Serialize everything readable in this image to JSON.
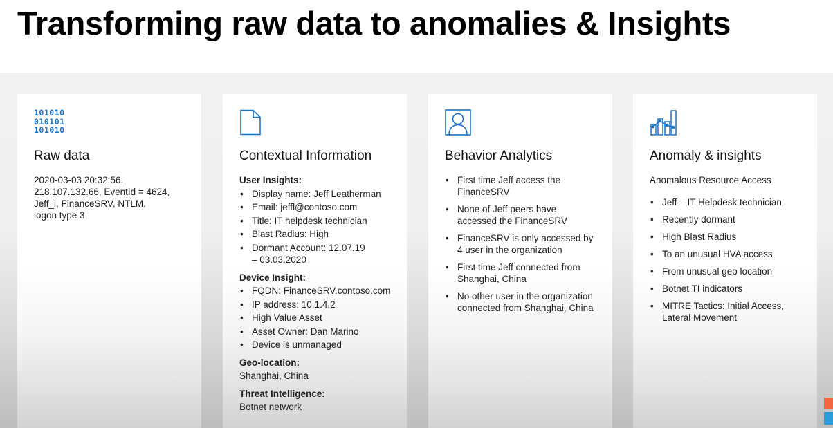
{
  "title": "Transforming raw data to anomalies & Insights",
  "colors": {
    "icon_accent": "#0a6fc9",
    "tile_orange": "#f0673f",
    "tile_blue": "#2a9bdd"
  },
  "cards": [
    {
      "icon": "binary-icon",
      "binary_lines": [
        "101010",
        "010101",
        "101010"
      ],
      "heading": "Raw data",
      "lines": [
        "2020-03-03 20:32:56,",
        "218.107.132.66, EventId = 4624,",
        "Jeff_l, FinanceSRV, NTLM,",
        "logon type 3"
      ]
    },
    {
      "icon": "document-icon",
      "heading": "Contextual Information",
      "sections": [
        {
          "title": "User Insights:",
          "items": [
            "Display name: Jeff Leatherman",
            "Email: jeffl@contoso.com",
            "Title: IT helpdesk technician",
            "Blast Radius: High",
            "Dormant Account: 12.07.19 – 03.03.2020"
          ]
        },
        {
          "title": "Device Insight:",
          "items": [
            "FQDN: FinanceSRV.contoso.com",
            "IP address: 10.1.4.2",
            "High Value Asset",
            "Asset Owner: Dan Marino",
            "Device is unmanaged"
          ]
        },
        {
          "title": "Geo-location:",
          "text": "Shanghai, China"
        },
        {
          "title": "Threat Intelligence:",
          "text": "Botnet network"
        }
      ]
    },
    {
      "icon": "user-icon",
      "heading": "Behavior Analytics",
      "items": [
        "First time Jeff access the FinanceSRV",
        "None of Jeff peers have accessed the FinanceSRV",
        "FinanceSRV is only accessed by 4 user in the organization",
        "First time Jeff connected from Shanghai, China",
        "No other user in the organization connected from Shanghai, China"
      ]
    },
    {
      "icon": "analytics-chart-icon",
      "heading": "Anomaly & insights",
      "subtitle": "Anomalous Resource Access",
      "items": [
        "Jeff – IT Helpdesk technician",
        "Recently dormant",
        "High Blast Radius",
        "To an unusual HVA access",
        "From unusual geo location",
        "Botnet TI indicators",
        "MITRE Tactics: Initial Access, Lateral Movement"
      ]
    }
  ]
}
